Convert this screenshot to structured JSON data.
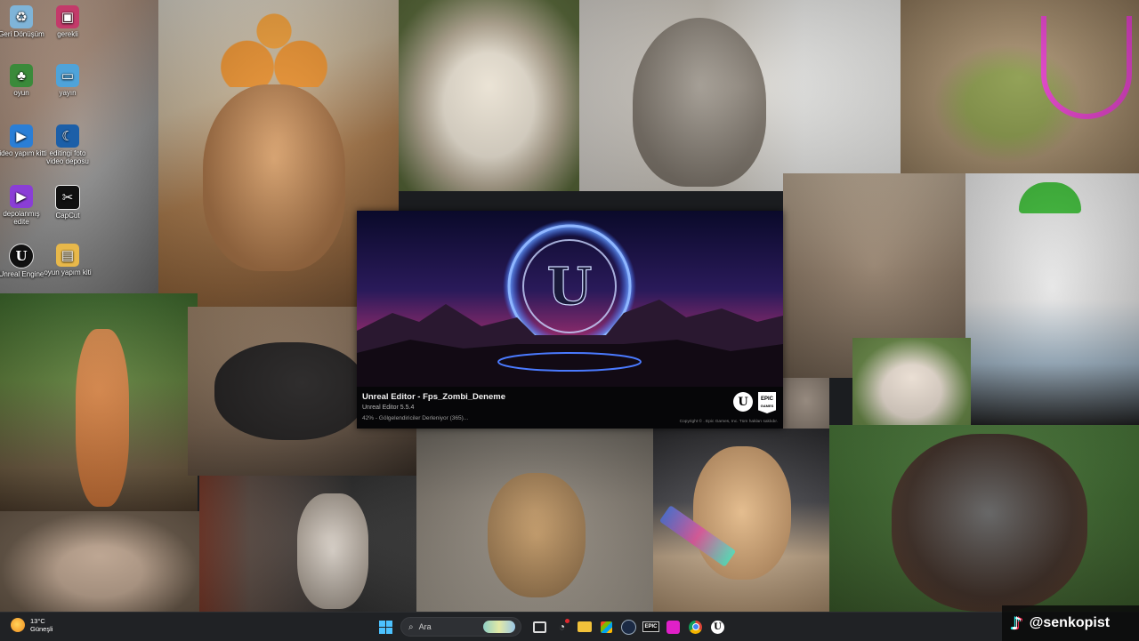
{
  "desktop": {
    "icons": [
      {
        "label": "Geri Dönüşüm",
        "icon": "recycle-bin-icon",
        "color": "#7fb4d8"
      },
      {
        "label": "gerekli",
        "icon": "folder-icon",
        "color": "#c33a6a"
      },
      {
        "label": "oyun",
        "icon": "tree-icon",
        "color": "#3a8a3a"
      },
      {
        "label": "yayın",
        "icon": "stream-icon",
        "color": "#4fa3d9"
      },
      {
        "label": "video yapım kitti",
        "icon": "video-icon",
        "color": "#2a7ed6"
      },
      {
        "label": "editingi foto video deposu",
        "icon": "moon-icon",
        "color": "#1c5fa8"
      },
      {
        "label": "depolanmış edite",
        "icon": "play-icon",
        "color": "#8a3ed6"
      },
      {
        "label": "CapCut",
        "icon": "capcut-icon",
        "color": "#111111"
      },
      {
        "label": "Unreal Engine",
        "icon": "unreal-icon",
        "color": "#111111"
      },
      {
        "label": "oyun yapım kiti",
        "icon": "folder-icon",
        "color": "#e8b84a"
      }
    ]
  },
  "splash": {
    "title": "Unreal Editor - Fps_Zombi_Deneme",
    "version": "Unreal Editor 5.5.4",
    "status": "42% - Gölgelendiriciler Derleniyor (365)...",
    "progress": 0.42,
    "copyright": "Copyright © . Epic Games, Inc. Tüm hakları saklıdır.",
    "logo_u": "U",
    "logo_epic_top": "EPIC",
    "logo_epic_bottom": "GAMES"
  },
  "taskbar": {
    "temperature": "13°C",
    "condition": "Güneşli",
    "search_placeholder": "Ara",
    "apps": [
      "start",
      "search",
      "task-view",
      "shield",
      "file-explorer",
      "store",
      "steam",
      "epic-games",
      "pink-app",
      "chrome",
      "unreal"
    ]
  },
  "overlay": {
    "handle": "@senkopist",
    "note": "♪"
  }
}
